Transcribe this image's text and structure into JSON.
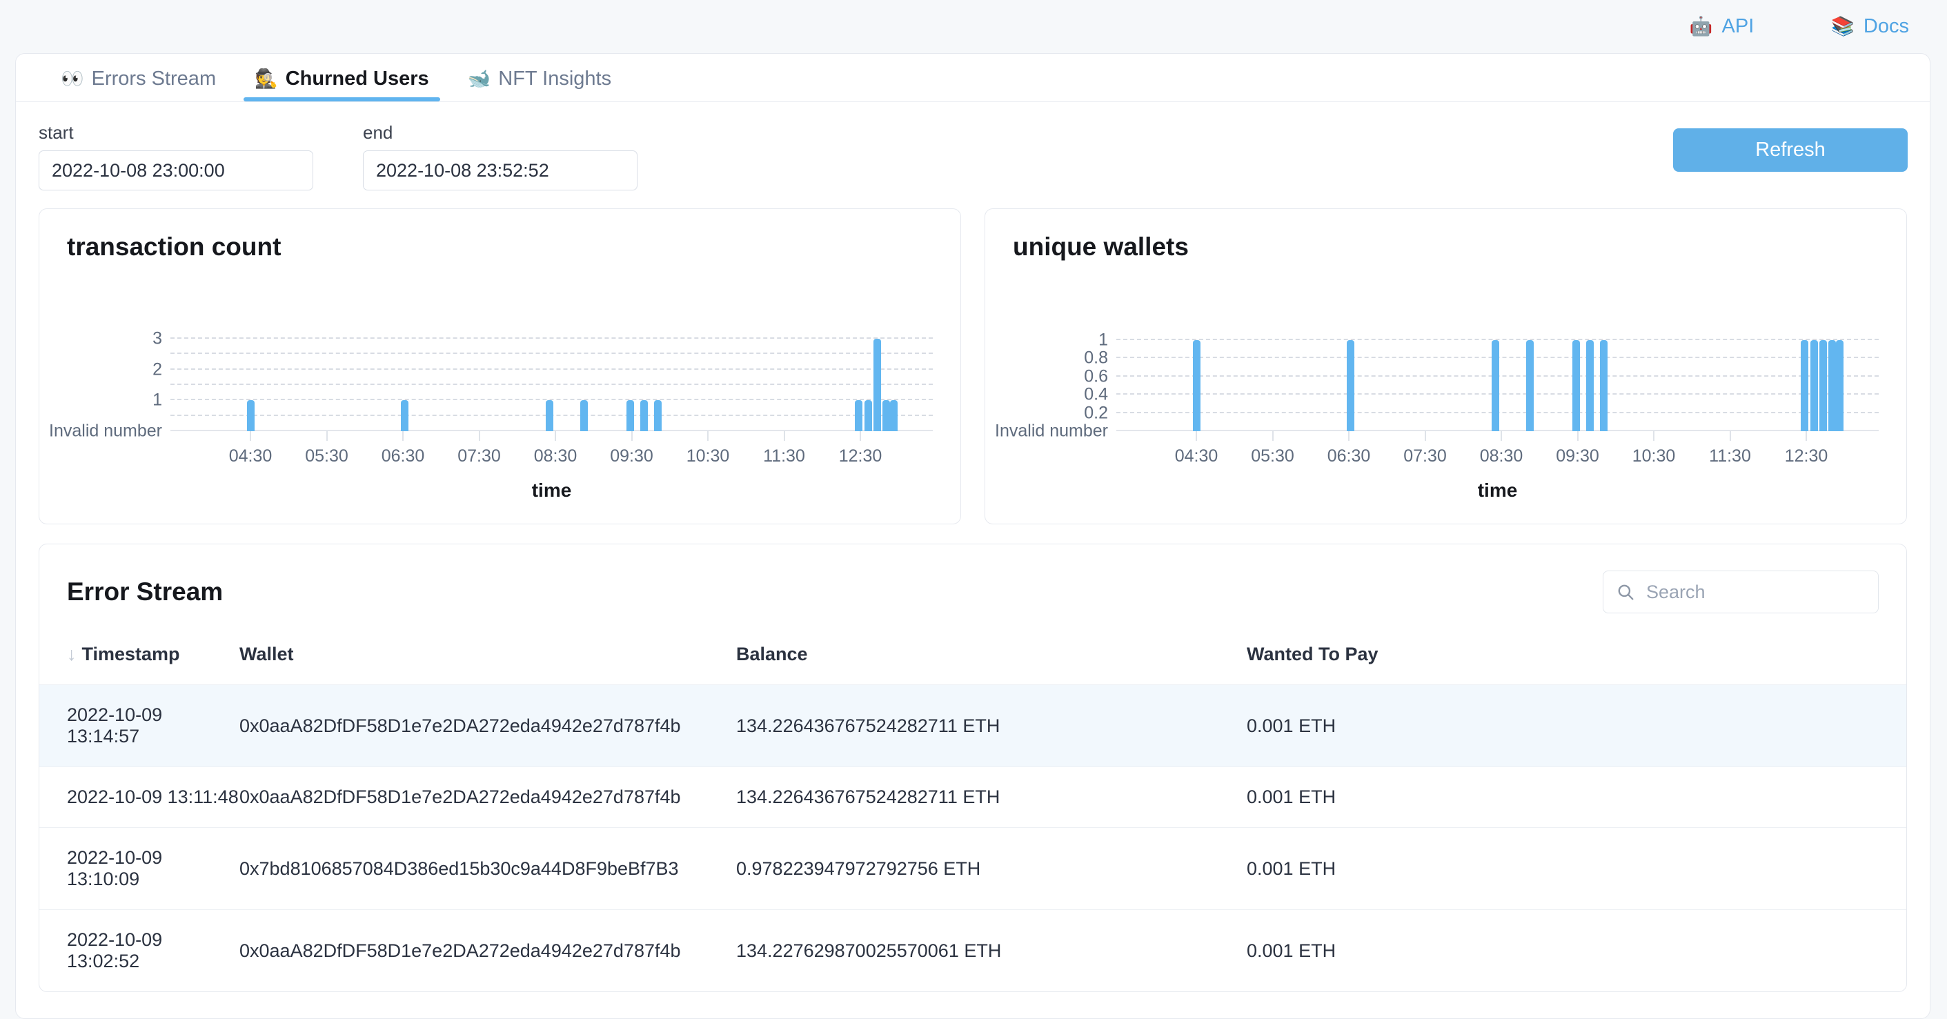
{
  "topbar": {
    "links": [
      {
        "label": "API",
        "icon": "robot-emoji",
        "glyph": "🤖"
      },
      {
        "label": "Docs",
        "icon": "books-emoji",
        "glyph": "📚"
      }
    ],
    "accent": "#4fa3e3"
  },
  "tabs": [
    {
      "label": "Errors Stream",
      "icon": "eyes-emoji",
      "glyph": "👀",
      "active": false
    },
    {
      "label": "Churned Users",
      "icon": "detective-emoji",
      "glyph": "🕵️",
      "active": true
    },
    {
      "label": "NFT Insights",
      "icon": "whale-emoji",
      "glyph": "🐋",
      "active": false
    }
  ],
  "filters": {
    "start": {
      "label": "start",
      "value": "2022-10-08 23:00:00",
      "placeholder": "start"
    },
    "end": {
      "label": "end",
      "value": "2022-10-08 23:52:52",
      "placeholder": "end"
    },
    "refresh_label": "Refresh",
    "refresh_color": "#60b0e8"
  },
  "chart_data": [
    {
      "type": "bar",
      "title": "transaction count",
      "xlabel": "time",
      "ylabel": "",
      "ylim": [
        0,
        3.4
      ],
      "grid": true,
      "bar_color": "#62b6f0",
      "ytick_labels": [
        "Invalid number",
        "1",
        "2",
        "3"
      ],
      "ytick_values": [
        0,
        1,
        2,
        3
      ],
      "gridline_values": [
        0.5,
        1,
        1.5,
        2,
        2.5,
        3
      ],
      "xtick_labels": [
        "04:30",
        "05:30",
        "06:30",
        "07:30",
        "08:30",
        "09:30",
        "10:30",
        "11:30",
        "12:30"
      ],
      "xtick_positions": [
        0.105,
        0.205,
        0.305,
        0.405,
        0.505,
        0.605,
        0.705,
        0.805,
        0.905
      ],
      "x": [
        0.1,
        0.302,
        0.492,
        0.538,
        0.598,
        0.616,
        0.634,
        0.898,
        0.91,
        0.922,
        0.934,
        0.944
      ],
      "values": [
        1,
        1,
        1,
        1,
        1,
        1,
        1,
        1,
        1,
        3,
        1,
        1
      ]
    },
    {
      "type": "bar",
      "title": "unique wallets",
      "xlabel": "time",
      "ylabel": "",
      "ylim": [
        0,
        1.15
      ],
      "grid": true,
      "bar_color": "#62b6f0",
      "ytick_labels": [
        "Invalid number",
        "0.2",
        "0.4",
        "0.6",
        "0.8",
        "1"
      ],
      "ytick_values": [
        0,
        0.2,
        0.4,
        0.6,
        0.8,
        1
      ],
      "gridline_values": [
        0.2,
        0.4,
        0.6,
        0.8,
        1
      ],
      "xtick_labels": [
        "04:30",
        "05:30",
        "06:30",
        "07:30",
        "08:30",
        "09:30",
        "10:30",
        "11:30",
        "12:30"
      ],
      "xtick_positions": [
        0.105,
        0.205,
        0.305,
        0.405,
        0.505,
        0.605,
        0.705,
        0.805,
        0.905
      ],
      "x": [
        0.1,
        0.302,
        0.492,
        0.538,
        0.598,
        0.616,
        0.634,
        0.898,
        0.91,
        0.922,
        0.934,
        0.944
      ],
      "values": [
        1,
        1,
        1,
        1,
        1,
        1,
        1,
        1,
        1,
        1,
        1,
        1
      ]
    }
  ],
  "error_stream": {
    "title": "Error Stream",
    "search": {
      "value": "",
      "placeholder": "Search",
      "icon": "search-icon"
    },
    "sort": {
      "column": "Timestamp",
      "direction": "desc",
      "arrow": "↓"
    },
    "columns": [
      "Timestamp",
      "Wallet",
      "Balance",
      "Wanted To Pay"
    ],
    "rows": [
      {
        "timestamp": "2022-10-09 13:14:57",
        "wallet": "0x0aaA82DfDF58D1e7e2DA272eda4942e27d787f4b",
        "balance": "134.226436767524282711 ETH",
        "wanted_to_pay": "0.001 ETH",
        "highlight": true
      },
      {
        "timestamp": "2022-10-09 13:11:48",
        "wallet": "0x0aaA82DfDF58D1e7e2DA272eda4942e27d787f4b",
        "balance": "134.226436767524282711 ETH",
        "wanted_to_pay": "0.001 ETH",
        "highlight": false
      },
      {
        "timestamp": "2022-10-09 13:10:09",
        "wallet": "0x7bd8106857084D386ed15b30c9a44D8F9beBf7B3",
        "balance": "0.978223947972792756 ETH",
        "wanted_to_pay": "0.001 ETH",
        "highlight": false
      },
      {
        "timestamp": "2022-10-09 13:02:52",
        "wallet": "0x0aaA82DfDF58D1e7e2DA272eda4942e27d787f4b",
        "balance": "134.227629870025570061 ETH",
        "wanted_to_pay": "0.001 ETH",
        "highlight": false
      }
    ]
  }
}
